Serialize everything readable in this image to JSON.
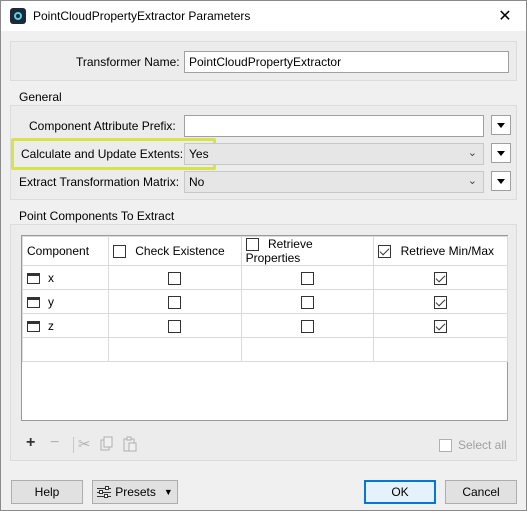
{
  "window": {
    "title": "PointCloudPropertyExtractor Parameters",
    "close_glyph": "✕"
  },
  "transformer": {
    "label": "Transformer Name:",
    "value": "PointCloudPropertyExtractor"
  },
  "general": {
    "group_label": "General",
    "prefix_label": "Component Attribute Prefix:",
    "prefix_value": "",
    "extents_label": "Calculate and Update Extents:",
    "extents_value": "Yes",
    "matrix_label": "Extract Transformation Matrix:",
    "matrix_value": "No"
  },
  "components": {
    "group_label": "Point Components To Extract",
    "headers": [
      "Component",
      "Check Existence",
      "Retrieve Properties",
      "Retrieve Min/Max"
    ],
    "header_checked": [
      false,
      false,
      true
    ],
    "rows": [
      {
        "name": "x",
        "check_existence": false,
        "retrieve_properties": false,
        "retrieve_minmax": true
      },
      {
        "name": "y",
        "check_existence": false,
        "retrieve_properties": false,
        "retrieve_minmax": true
      },
      {
        "name": "z",
        "check_existence": false,
        "retrieve_properties": false,
        "retrieve_minmax": true
      }
    ]
  },
  "toolbar": {
    "add_glyph": "+",
    "remove_glyph": "−",
    "icons": [
      "plus-icon",
      "minus-icon",
      "cut-icon",
      "copy-icon",
      "paste-icon"
    ],
    "select_all_label": "Select all"
  },
  "buttons": {
    "help": "Help",
    "presets": "Presets",
    "ok": "OK",
    "cancel": "Cancel"
  },
  "colors": {
    "highlight": "#d7e34a",
    "primary_border": "#0078d7"
  }
}
